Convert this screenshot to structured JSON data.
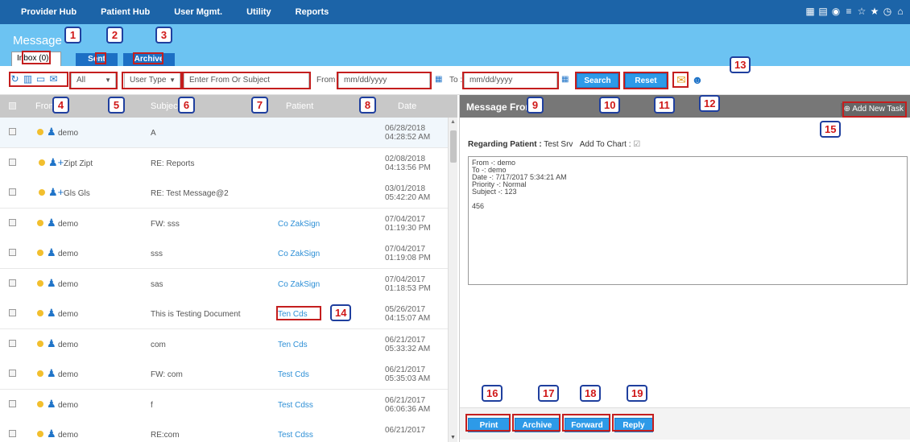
{
  "nav": {
    "items": [
      "Provider Hub",
      "Patient Hub",
      "User Mgmt.",
      "Utility",
      "Reports"
    ],
    "quick_icons": [
      "grid-icon",
      "list-icon",
      "dashboard-icon",
      "menu-icon",
      "star-outline-icon",
      "star-icon",
      "clock-icon",
      "home-icon"
    ]
  },
  "header": {
    "title": "Message",
    "tabs": {
      "inbox": "Inbox (0)",
      "sent": "Sent",
      "archive": "Archive"
    }
  },
  "toolbar": {
    "icons": [
      "refresh-icon",
      "delete-icon",
      "inbox-icon",
      "mail-icon"
    ],
    "filter_select": "All",
    "user_type_select": "User Type",
    "search_placeholder": "Enter From Or Subject",
    "from_label": "From :",
    "from_placeholder": "mm/dd/yyyy",
    "to_label": "To :",
    "to_placeholder": "mm/dd/yyyy",
    "search_button": "Search",
    "reset_button": "Reset"
  },
  "list": {
    "columns": {
      "from": "From",
      "subject": "Subject",
      "patient": "Patient",
      "date": "Date"
    },
    "rows": [
      {
        "from": "demo",
        "subject": "A",
        "patient": "",
        "date": "06/28/2018",
        "time": "04:28:52 AM",
        "group": false
      },
      {
        "from": "Zipt Zipt",
        "subject": "RE: Reports",
        "patient": "",
        "date": "02/08/2018",
        "time": "04:13:56 PM",
        "group": true
      },
      {
        "from": "Gls Gls",
        "subject": "RE: Test Message@2",
        "patient": "",
        "date": "03/01/2018",
        "time": "05:42:20 AM",
        "group": true
      },
      {
        "from": "demo",
        "subject": "FW: sss",
        "patient": "Co ZakSign",
        "date": "07/04/2017",
        "time": "01:19:30 PM",
        "group": false
      },
      {
        "from": "demo",
        "subject": "sss",
        "patient": "Co ZakSign",
        "date": "07/04/2017",
        "time": "01:19:08 PM",
        "group": false
      },
      {
        "from": "demo",
        "subject": "sas",
        "patient": "Co ZakSign",
        "date": "07/04/2017",
        "time": "01:18:53 PM",
        "group": false
      },
      {
        "from": "demo",
        "subject": "This is Testing Document",
        "patient": "Ten Cds",
        "date": "05/26/2017",
        "time": "04:15:07 AM",
        "group": false
      },
      {
        "from": "demo",
        "subject": "com",
        "patient": "Ten Cds",
        "date": "06/21/2017",
        "time": "05:33:32 AM",
        "group": false
      },
      {
        "from": "demo",
        "subject": "FW: com",
        "patient": "Test Cds",
        "date": "06/21/2017",
        "time": "05:35:03 AM",
        "group": false
      },
      {
        "from": "demo",
        "subject": "f",
        "patient": "Test Cdss",
        "date": "06/21/2017",
        "time": "06:06:36 AM",
        "group": false
      },
      {
        "from": "demo",
        "subject": "RE:com",
        "patient": "Test Cdss",
        "date": "06/21/2017",
        "time": "",
        "group": false
      }
    ]
  },
  "detail": {
    "header": "Message From",
    "add_task": "Add New Task",
    "regarding_label": "Regarding Patient :",
    "regarding_value": "Test Srv",
    "add_to_chart": "Add To Chart :",
    "message_body": "From -:  demo\nTo -:  demo\nDate -:  7/17/2017 5:34:21 AM\nPriority -:  Normal\nSubject -:  123\n\n456",
    "buttons": {
      "print": "Print",
      "archive": "Archive",
      "forward": "Forward",
      "reply": "Reply"
    }
  },
  "callouts": [
    "1",
    "2",
    "3",
    "4",
    "5",
    "6",
    "7",
    "8",
    "9",
    "10",
    "11",
    "12",
    "13",
    "14",
    "15",
    "16",
    "17",
    "18",
    "19"
  ],
  "colors": {
    "nav": "#1c64a8",
    "header": "#6cc3f2",
    "accent": "#2d9ae8",
    "callout_text": "#d01818",
    "callout_border": "#1f3f9e",
    "highlight_box": "#c41e1e"
  }
}
